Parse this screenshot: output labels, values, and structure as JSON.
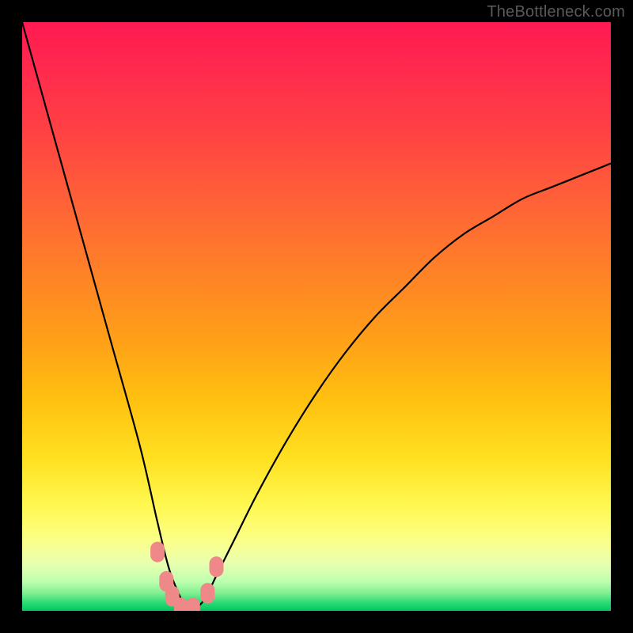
{
  "watermark": "TheBottleneck.com",
  "chart_data": {
    "type": "line",
    "title": "",
    "xlabel": "",
    "ylabel": "",
    "xlim": [
      0,
      100
    ],
    "ylim": [
      0,
      100
    ],
    "curve_description": "V-shaped bottleneck curve: descends steeply from upper-left, reaches minimum near x≈28, then rises with decreasing slope toward upper-right",
    "x": [
      0,
      5,
      10,
      15,
      20,
      23,
      25,
      27,
      28,
      29,
      31,
      33,
      36,
      40,
      45,
      50,
      55,
      60,
      65,
      70,
      75,
      80,
      85,
      90,
      95,
      100
    ],
    "y": [
      100,
      82,
      64,
      46,
      28,
      15,
      7,
      2,
      0,
      0,
      2,
      6,
      12,
      20,
      29,
      37,
      44,
      50,
      55,
      60,
      64,
      67,
      70,
      72,
      74,
      76
    ],
    "markers": {
      "description": "Pink rounded markers clustered near the curve minimum on both sides",
      "points": [
        {
          "x": 23.0,
          "y": 10.0
        },
        {
          "x": 24.5,
          "y": 5.0
        },
        {
          "x": 25.5,
          "y": 2.5
        },
        {
          "x": 27.0,
          "y": 0.5
        },
        {
          "x": 29.0,
          "y": 0.5
        },
        {
          "x": 31.5,
          "y": 3.0
        },
        {
          "x": 33.0,
          "y": 7.5
        }
      ],
      "color": "#ef8888"
    },
    "gradient_zones": [
      {
        "zone": "danger",
        "color_top": "#ff1a52",
        "approx_y_range": [
          60,
          100
        ]
      },
      {
        "zone": "warning",
        "color_mid": "#ffa018",
        "approx_y_range": [
          20,
          60
        ]
      },
      {
        "zone": "good",
        "color_bottom": "#00c85c",
        "approx_y_range": [
          0,
          5
        ]
      }
    ]
  }
}
